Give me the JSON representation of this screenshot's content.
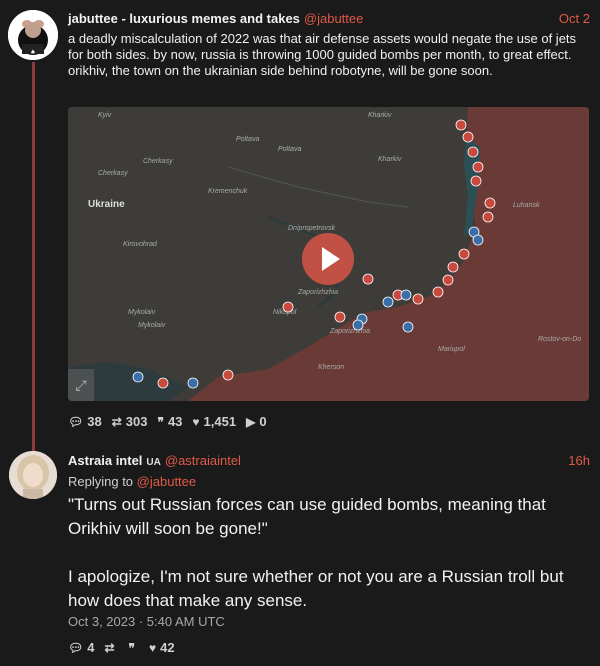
{
  "tweet1": {
    "name": "jabuttee - luxurious memes and takes",
    "handle": "@jabuttee",
    "time": "Oct 2",
    "text": "a deadly miscalculation of 2022 was that air defense assets would negate the use of jets for both sides. by now, russia is throwing 1000 guided bombs per month, to great effect. orikhiv, the town on the ukrainian side behind robotyne, will be gone soon.",
    "map_labels": {
      "kyiv": "Kyiv",
      "kharkiv": "Kharkiv",
      "poltava_a": "Poltava",
      "poltava_b": "Poltava",
      "kharkiv2": "Kharkiv",
      "cherkasy_a": "Cherkasy",
      "cherkasy_b": "Cherkasy",
      "kremenchuk": "Kremenchuk",
      "ukraine": "Ukraine",
      "luhansk": "Luhansk",
      "dnipropetrovsk": "Dnipropetrovsk",
      "kirovohrad": "Kirovohrad",
      "zaporizhzhia": "Zaporizhzhia",
      "nikopol": "Nikopol",
      "mykolaiv_a": "Mykolaiv",
      "mykolaiv_b": "Mykolaiv",
      "zaporizhzhia2": "Zaporizhzhia",
      "mariupol": "Mariupol",
      "rostov": "Rostov-on-Do",
      "kherson": "Kherson"
    },
    "stats": {
      "replies": "38",
      "retweets": "303",
      "quotes": "43",
      "likes": "1,451",
      "views": "0"
    }
  },
  "tweet2": {
    "name": "Astraia intel",
    "flag": "UA",
    "handle": "@astraiaintel",
    "time": "16h",
    "replying_prefix": "Replying to",
    "replying_handle": "@jabuttee",
    "text_p1": "\"Turns out Russian forces can use guided bombs, meaning that Orikhiv will soon be gone!\"",
    "text_p2": "I apologize, I'm not sure whether or not you are a Russian troll but how does that make any sense.",
    "timestamp": "Oct 3, 2023 · 5:40 AM UTC",
    "stats": {
      "replies": "4",
      "likes": "42"
    }
  },
  "icons": {
    "reply": "reply-icon",
    "retweet": "retweet-icon",
    "quote": "quote-icon",
    "like": "heart-icon",
    "views": "play-icon"
  },
  "colors": {
    "accent": "#e05a47",
    "thread_line": "#8b3a3a",
    "background": "#1a1a1a"
  }
}
